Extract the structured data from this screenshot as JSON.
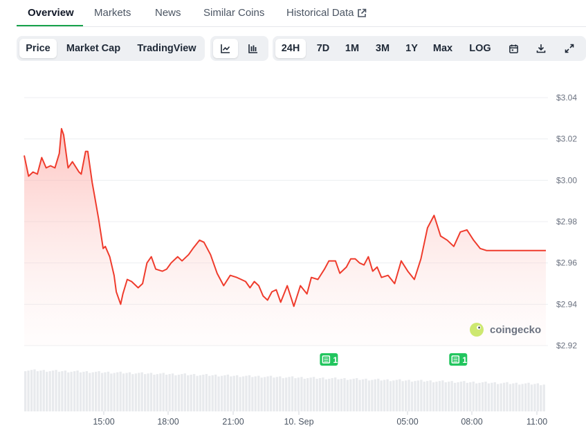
{
  "tabs": [
    {
      "label": "Overview",
      "active": true
    },
    {
      "label": "Markets"
    },
    {
      "label": "News"
    },
    {
      "label": "Similar Coins"
    },
    {
      "label": "Historical Data"
    }
  ],
  "metric_toggle": {
    "price": "Price",
    "market_cap": "Market Cap",
    "tradingview": "TradingView",
    "selected": "Price"
  },
  "chart_type_toggle": {
    "selected": "line",
    "icons": [
      "line-chart-icon",
      "candlestick-icon"
    ]
  },
  "range_toggle": {
    "options": [
      "24H",
      "7D",
      "1M",
      "3M",
      "1Y",
      "Max",
      "LOG"
    ],
    "selected": "24H"
  },
  "tool_icons": [
    "calendar-icon",
    "download-icon",
    "fullscreen-icon"
  ],
  "watermark": "coingecko",
  "colors": {
    "line": "#ef3b2c",
    "fill": "#fde2e0",
    "volume": "#e5e7eb",
    "badge": "#22c55e",
    "accent": "#16a34a"
  },
  "chart_data": {
    "type": "area",
    "title": "",
    "xlabel": "",
    "ylabel": "",
    "y_ticks": [
      "$3.04",
      "$3.02",
      "$3.00",
      "$2.98",
      "$2.96",
      "$2.94",
      "$2.92"
    ],
    "x_ticks": [
      "15:00",
      "18:00",
      "21:00",
      "10. Sep",
      "05:00",
      "08:00",
      "11:00"
    ],
    "ylim": [
      2.92,
      3.04
    ],
    "xlim": [
      11.3,
      35.1
    ],
    "grid": true,
    "series": [
      {
        "x": [
          11.3,
          11.5,
          11.7,
          11.9,
          12.1,
          12.3,
          12.5,
          12.7,
          12.9,
          13.0,
          13.1,
          13.3,
          13.5,
          13.8,
          13.9,
          14.1,
          14.2,
          14.4,
          14.5,
          14.7,
          14.9,
          15.0,
          15.2,
          15.4,
          15.5,
          15.7,
          15.8,
          16.0,
          16.2,
          16.5,
          16.7,
          16.9,
          17.1,
          17.3,
          17.6,
          17.8,
          18.0,
          18.3,
          18.5,
          18.8,
          19.0,
          19.3,
          19.5,
          19.8,
          20.1,
          20.4,
          20.7,
          21.0,
          21.2,
          21.4,
          21.6,
          21.8,
          22.0,
          22.2,
          22.4,
          22.6,
          22.8,
          23.0,
          23.3,
          23.6,
          23.9,
          24.2,
          24.4,
          24.7,
          25.0,
          25.2,
          25.5,
          25.7,
          26.0,
          26.2,
          26.4,
          26.6,
          26.8,
          27.0,
          27.2,
          27.4,
          27.6,
          27.9,
          28.2,
          28.5,
          28.8,
          29.1,
          29.4,
          29.7,
          30.0,
          30.3,
          30.6,
          30.9,
          31.2,
          31.5,
          31.8,
          32.1,
          32.4,
          32.6,
          32.8,
          33.0,
          33.2,
          33.4,
          33.6,
          33.8,
          34.0,
          34.3,
          34.6,
          34.9,
          35.1
        ],
        "y": [
          3.012,
          3.002,
          3.004,
          3.003,
          3.011,
          3.006,
          3.007,
          3.006,
          3.013,
          3.025,
          3.022,
          3.006,
          3.009,
          3.004,
          3.003,
          3.014,
          3.014,
          2.999,
          2.993,
          2.981,
          2.967,
          2.968,
          2.963,
          2.954,
          2.946,
          2.94,
          2.945,
          2.952,
          2.951,
          2.948,
          2.95,
          2.96,
          2.963,
          2.957,
          2.956,
          2.957,
          2.96,
          2.963,
          2.961,
          2.964,
          2.967,
          2.971,
          2.97,
          2.964,
          2.955,
          2.949,
          2.954,
          2.953,
          2.952,
          2.951,
          2.948,
          2.951,
          2.949,
          2.944,
          2.942,
          2.946,
          2.947,
          2.941,
          2.949,
          2.939,
          2.949,
          2.945,
          2.953,
          2.952,
          2.957,
          2.961,
          2.961,
          2.955,
          2.958,
          2.962,
          2.962,
          2.96,
          2.959,
          2.963,
          2.956,
          2.958,
          2.953,
          2.954,
          2.95,
          2.961,
          2.956,
          2.952,
          2.962,
          2.977,
          2.983,
          2.973,
          2.971,
          2.968,
          2.975,
          2.976,
          2.971,
          2.967,
          2.966,
          2.966,
          2.966,
          2.966,
          2.966,
          2.966,
          2.966,
          2.966,
          2.966,
          2.966,
          2.966,
          2.966,
          2.966
        ]
      }
    ],
    "news_markers": [
      {
        "x": 25.2,
        "count": "1"
      },
      {
        "x": 31.1,
        "count": "1"
      }
    ]
  }
}
